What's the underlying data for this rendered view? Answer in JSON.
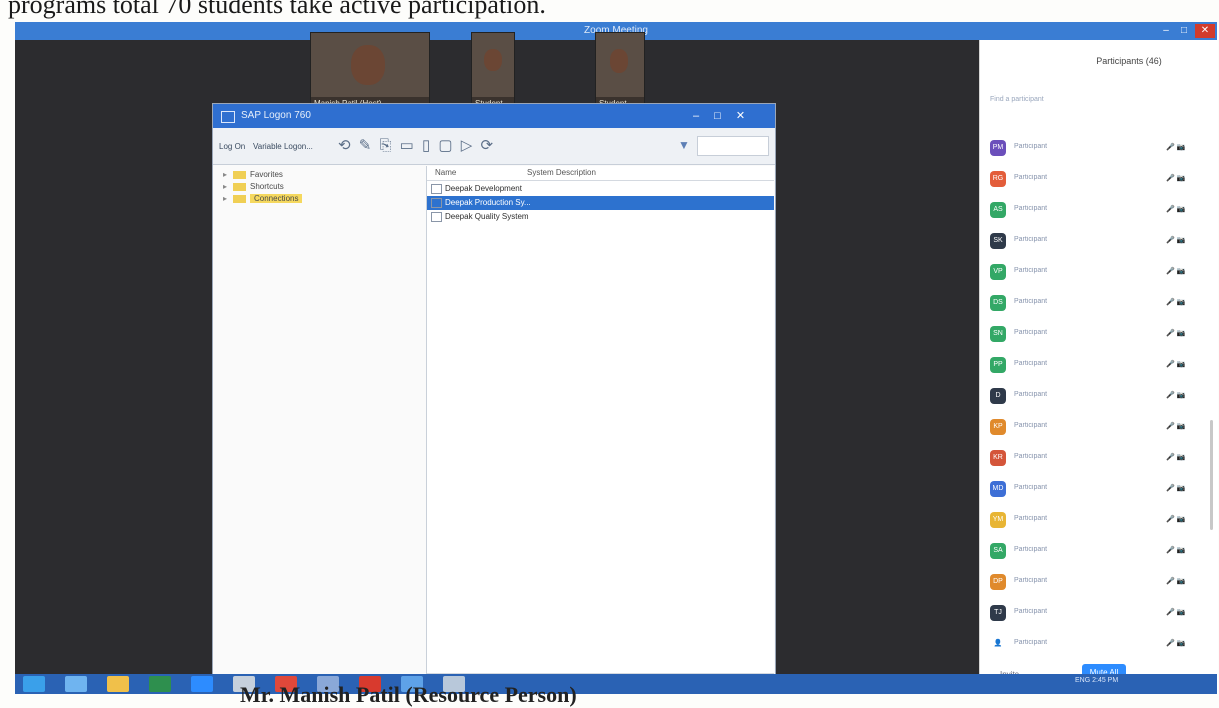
{
  "top_caption": "programs total 70 students take active participation.",
  "bottom_caption": "Mr. Manish Patil (Resource Person)",
  "zoom": {
    "title": "Zoom Meeting",
    "controls": [
      "–",
      "□",
      "✕"
    ],
    "videos": [
      {
        "name": "Manish Patil (Host)"
      },
      {
        "name": "Student"
      },
      {
        "name": "Student"
      }
    ]
  },
  "sap": {
    "title": "SAP Logon 760",
    "window_controls": "– □ ✕",
    "toolbar": {
      "log_on": "Log On",
      "variable_logon": "Variable Logon...",
      "icons": "⟲ ✎ ⎘ ▭ ▯ ▢ ▷ ⟳"
    },
    "tree": [
      {
        "label": "Favorites",
        "selected": false
      },
      {
        "label": "Shortcuts",
        "selected": false
      },
      {
        "label": "Connections",
        "selected": true
      }
    ],
    "list_headers": {
      "name": "Name",
      "desc": "System Description"
    },
    "connections": [
      {
        "label": "Deepak Development",
        "selected": false
      },
      {
        "label": "Deepak Production Sy...",
        "selected": true
      },
      {
        "label": "Deepak Quality System",
        "selected": false
      }
    ],
    "scroll_left": "◂  ▸",
    "scroll_right": "◂  ▸"
  },
  "participants": {
    "title": "Participants (46)",
    "subtitle": "Find a participant",
    "list": [
      {
        "initials": "PM",
        "color": "#6b4fbb",
        "name": "Participant",
        "status": "🎤 📷"
      },
      {
        "initials": "RG",
        "color": "#e35d3a",
        "name": "Participant",
        "status": "🎤 📷"
      },
      {
        "initials": "AS",
        "color": "#33a866",
        "name": "Participant",
        "status": "🎤 📷"
      },
      {
        "initials": "SK",
        "color": "#2f3a4a",
        "name": "Participant",
        "status": "🎤 📷"
      },
      {
        "initials": "VP",
        "color": "#33a866",
        "name": "Participant",
        "status": "🎤 📷"
      },
      {
        "initials": "DS",
        "color": "#33a866",
        "name": "Participant",
        "status": "🎤 📷"
      },
      {
        "initials": "SN",
        "color": "#33a866",
        "name": "Participant",
        "status": "🎤 📷"
      },
      {
        "initials": "PP",
        "color": "#33a866",
        "name": "Participant",
        "status": "🎤 📷"
      },
      {
        "initials": "D",
        "color": "#2f3a4a",
        "name": "Participant",
        "status": "🎤 📷"
      },
      {
        "initials": "KP",
        "color": "#e08a2c",
        "name": "Participant",
        "status": "🎤 📷"
      },
      {
        "initials": "KR",
        "color": "#d4553a",
        "name": "Participant",
        "status": "🎤 📷"
      },
      {
        "initials": "MD",
        "color": "#3d6fd6",
        "name": "Participant",
        "status": "🎤 📷"
      },
      {
        "initials": "YM",
        "color": "#e8b534",
        "name": "Participant",
        "status": "🎤 📷"
      },
      {
        "initials": "SA",
        "color": "#33a866",
        "name": "Participant",
        "status": "🎤 📷"
      },
      {
        "initials": "DP",
        "color": "#e08a2c",
        "name": "Participant",
        "status": "🎤 📷"
      },
      {
        "initials": "TJ",
        "color": "#2f3a4a",
        "name": "Participant",
        "status": "🎤 📷"
      },
      {
        "initials": "👤",
        "color": "#ffffff",
        "name": "Participant",
        "status": "🎤 📷"
      }
    ],
    "invite": "Invite",
    "mute_all": "Mute All"
  },
  "taskbar": {
    "apps": [
      "start",
      "ie",
      "explorer",
      "outlook",
      "zoom",
      "paint",
      "chrome",
      "media",
      "acrobat",
      "chat",
      "misc"
    ],
    "tray": "ENG  2:45 PM"
  }
}
